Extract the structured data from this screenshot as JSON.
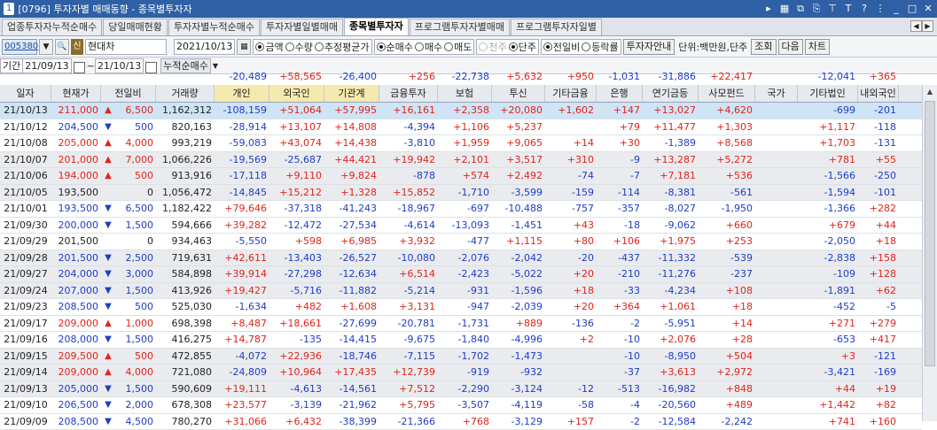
{
  "window": {
    "number": "1",
    "title": "[0796] 투자자별 매매동향 - 종목별투자자"
  },
  "tabs": [
    "업종투자자누적순매수",
    "당일매매현황",
    "투자자별누적순매수",
    "투자자별일별매매",
    "종목별투자자",
    "프로그램투자자별매매",
    "프로그램투자자일별"
  ],
  "active_tab": "종목별투자자",
  "toolbar": {
    "code": "005380",
    "sin_badge": "신",
    "stock_name": "현대차",
    "date": "2021/10/13",
    "radio_a": [
      {
        "label": "금액",
        "on": true
      },
      {
        "label": "수량",
        "on": false
      },
      {
        "label": "추정평균가",
        "on": false
      }
    ],
    "radio_b": [
      {
        "label": "순매수",
        "on": true
      },
      {
        "label": "매수",
        "on": false
      },
      {
        "label": "매도",
        "on": false
      }
    ],
    "radio_c": [
      {
        "label": "천주",
        "on": false
      },
      {
        "label": "단주",
        "on": true
      }
    ],
    "radio_d": [
      {
        "label": "전일비",
        "on": true
      },
      {
        "label": "등락률",
        "on": false
      }
    ],
    "guide_btn": "투자자안내",
    "unit_label": "단위:백만원,단주",
    "query_btn": "조회",
    "next_btn": "다음",
    "chart_btn": "차트"
  },
  "period": {
    "label": "기간",
    "from": "21/09/13",
    "to": "21/10/13",
    "sum_label": "누적순매수"
  },
  "summary": [
    "-20,489",
    "+58,565",
    "-26,400",
    "+256",
    "-22,738",
    "+5,632",
    "+950",
    "-1,031",
    "-31,886",
    "+22,417",
    "",
    "-12,041",
    "+365"
  ],
  "headers": [
    "일자",
    "현재가",
    "전일비",
    "거래량",
    "개인",
    "외국인",
    "기관계",
    "금융투자",
    "보험",
    "투신",
    "기타금융",
    "은행",
    "연기금등",
    "사모펀드",
    "국가",
    "기타법인",
    "내외국인"
  ],
  "colors": {
    "up": "#e0241b",
    "down": "#1f3cc8",
    "title": "#2f5fa5",
    "selected": "#cfe4f5"
  },
  "rows": [
    {
      "date": "21/10/13",
      "price": "211,000",
      "dir": "up",
      "chg": "6,500",
      "vol": "1,162,312",
      "v": [
        "-108,159",
        "+51,064",
        "+57,995",
        "+16,161",
        "+2,358",
        "+20,080",
        "+1,602",
        "+147",
        "+13,027",
        "+4,620",
        "",
        "-699",
        "-201"
      ]
    },
    {
      "date": "21/10/12",
      "price": "204,500",
      "dir": "down",
      "chg": "500",
      "vol": "820,163",
      "v": [
        "-28,914",
        "+13,107",
        "+14,808",
        "-4,394",
        "+1,106",
        "+5,237",
        "",
        "+79",
        "+11,477",
        "+1,303",
        "",
        "+1,117",
        "-118"
      ]
    },
    {
      "date": "21/10/08",
      "price": "205,000",
      "dir": "up",
      "chg": "4,000",
      "vol": "993,219",
      "v": [
        "-59,083",
        "+43,074",
        "+14,438",
        "-3,810",
        "+1,959",
        "+9,065",
        "+14",
        "+30",
        "-1,389",
        "+8,568",
        "",
        "+1,703",
        "-131"
      ]
    },
    {
      "date": "21/10/07",
      "price": "201,000",
      "dir": "up",
      "chg": "7,000",
      "vol": "1,066,226",
      "v": [
        "-19,569",
        "-25,687",
        "+44,421",
        "+19,942",
        "+2,101",
        "+3,517",
        "+310",
        "-9",
        "+13,287",
        "+5,272",
        "",
        "+781",
        "+55"
      ]
    },
    {
      "date": "21/10/06",
      "price": "194,000",
      "dir": "up",
      "chg": "500",
      "vol": "913,916",
      "v": [
        "-17,118",
        "+9,110",
        "+9,824",
        "-878",
        "+574",
        "+2,492",
        "-74",
        "-7",
        "+7,181",
        "+536",
        "",
        "-1,566",
        "-250"
      ]
    },
    {
      "date": "21/10/05",
      "price": "193,500",
      "dir": "flat",
      "chg": "0",
      "vol": "1,056,472",
      "v": [
        "-14,845",
        "+15,212",
        "+1,328",
        "+15,852",
        "-1,710",
        "-3,599",
        "-159",
        "-114",
        "-8,381",
        "-561",
        "",
        "-1,594",
        "-101"
      ]
    },
    {
      "date": "21/10/01",
      "price": "193,500",
      "dir": "down",
      "chg": "6,500",
      "vol": "1,182,422",
      "v": [
        "+79,646",
        "-37,318",
        "-41,243",
        "-18,967",
        "-697",
        "-10,488",
        "-757",
        "-357",
        "-8,027",
        "-1,950",
        "",
        "-1,366",
        "+282"
      ]
    },
    {
      "date": "21/09/30",
      "price": "200,000",
      "dir": "down",
      "chg": "1,500",
      "vol": "594,666",
      "v": [
        "+39,282",
        "-12,472",
        "-27,534",
        "-4,614",
        "-13,093",
        "-1,451",
        "+43",
        "-18",
        "-9,062",
        "+660",
        "",
        "+679",
        "+44"
      ]
    },
    {
      "date": "21/09/29",
      "price": "201,500",
      "dir": "flat",
      "chg": "0",
      "vol": "934,463",
      "v": [
        "-5,550",
        "+598",
        "+6,985",
        "+3,932",
        "-477",
        "+1,115",
        "+80",
        "+106",
        "+1,975",
        "+253",
        "",
        "-2,050",
        "+18"
      ]
    },
    {
      "date": "21/09/28",
      "price": "201,500",
      "dir": "down",
      "chg": "2,500",
      "vol": "719,631",
      "v": [
        "+42,611",
        "-13,403",
        "-26,527",
        "-10,080",
        "-2,076",
        "-2,042",
        "-20",
        "-437",
        "-11,332",
        "-539",
        "",
        "-2,838",
        "+158"
      ]
    },
    {
      "date": "21/09/27",
      "price": "204,000",
      "dir": "down",
      "chg": "3,000",
      "vol": "584,898",
      "v": [
        "+39,914",
        "-27,298",
        "-12,634",
        "+6,514",
        "-2,423",
        "-5,022",
        "+20",
        "-210",
        "-11,276",
        "-237",
        "",
        "-109",
        "+128"
      ]
    },
    {
      "date": "21/09/24",
      "price": "207,000",
      "dir": "down",
      "chg": "1,500",
      "vol": "413,926",
      "v": [
        "+19,427",
        "-5,716",
        "-11,882",
        "-5,214",
        "-931",
        "-1,596",
        "+18",
        "-33",
        "-4,234",
        "+108",
        "",
        "-1,891",
        "+62"
      ]
    },
    {
      "date": "21/09/23",
      "price": "208,500",
      "dir": "down",
      "chg": "500",
      "vol": "525,030",
      "v": [
        "-1,634",
        "+482",
        "+1,608",
        "+3,131",
        "-947",
        "-2,039",
        "+20",
        "+364",
        "+1,061",
        "+18",
        "",
        "-452",
        "-5"
      ]
    },
    {
      "date": "21/09/17",
      "price": "209,000",
      "dir": "up",
      "chg": "1,000",
      "vol": "698,398",
      "v": [
        "+8,487",
        "+18,661",
        "-27,699",
        "-20,781",
        "-1,731",
        "+889",
        "-136",
        "-2",
        "-5,951",
        "+14",
        "",
        "+271",
        "+279"
      ]
    },
    {
      "date": "21/09/16",
      "price": "208,000",
      "dir": "down",
      "chg": "1,500",
      "vol": "416,275",
      "v": [
        "+14,787",
        "-135",
        "-14,415",
        "-9,675",
        "-1,840",
        "-4,996",
        "+2",
        "-10",
        "+2,076",
        "+28",
        "",
        "-653",
        "+417"
      ]
    },
    {
      "date": "21/09/15",
      "price": "209,500",
      "dir": "up",
      "chg": "500",
      "vol": "472,855",
      "v": [
        "-4,072",
        "+22,936",
        "-18,746",
        "-7,115",
        "-1,702",
        "-1,473",
        "",
        "-10",
        "-8,950",
        "+504",
        "",
        "+3",
        "-121"
      ]
    },
    {
      "date": "21/09/14",
      "price": "209,000",
      "dir": "up",
      "chg": "4,000",
      "vol": "721,080",
      "v": [
        "-24,809",
        "+10,964",
        "+17,435",
        "+12,739",
        "-919",
        "-932",
        "",
        "-37",
        "+3,613",
        "+2,972",
        "",
        "-3,421",
        "-169"
      ]
    },
    {
      "date": "21/09/13",
      "price": "205,000",
      "dir": "down",
      "chg": "1,500",
      "vol": "590,609",
      "v": [
        "+19,111",
        "-4,613",
        "-14,561",
        "+7,512",
        "-2,290",
        "-3,124",
        "-12",
        "-513",
        "-16,982",
        "+848",
        "",
        "+44",
        "+19"
      ]
    },
    {
      "date": "21/09/10",
      "price": "206,500",
      "dir": "down",
      "chg": "2,000",
      "vol": "678,308",
      "v": [
        "+23,577",
        "-3,139",
        "-21,962",
        "+5,795",
        "-3,507",
        "-4,119",
        "-58",
        "-4",
        "-20,560",
        "+489",
        "",
        "+1,442",
        "+82"
      ]
    },
    {
      "date": "21/09/09",
      "price": "208,500",
      "dir": "down",
      "chg": "4,500",
      "vol": "780,270",
      "v": [
        "+31,066",
        "+6,432",
        "-38,399",
        "-21,366",
        "+768",
        "-3,129",
        "+157",
        "-2",
        "-12,584",
        "-2,242",
        "",
        "+741",
        "+160"
      ]
    }
  ]
}
